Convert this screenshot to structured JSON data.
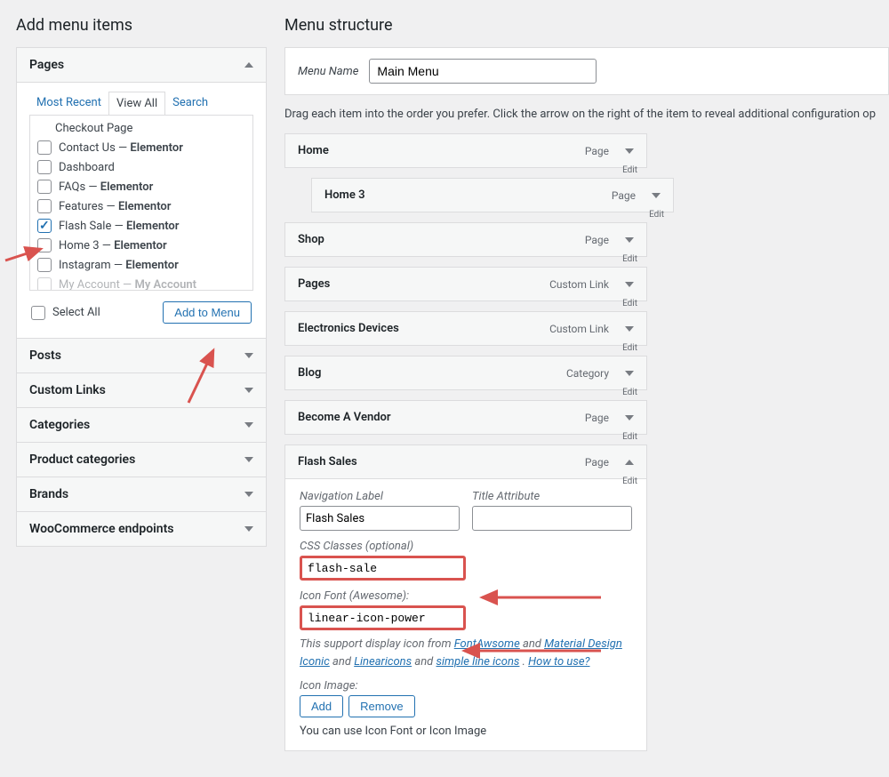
{
  "left": {
    "heading": "Add menu items",
    "pages_panel": {
      "title": "Pages",
      "tabs": {
        "recent": "Most Recent",
        "view_all": "View All",
        "search": "Search"
      },
      "items": [
        {
          "label": "Checkout Page",
          "suffix": "",
          "checked": false
        },
        {
          "label": "Contact Us",
          "suffix": " — Elementor",
          "checked": false
        },
        {
          "label": "Dashboard",
          "suffix": "",
          "checked": false
        },
        {
          "label": "FAQs",
          "suffix": " — Elementor",
          "checked": false
        },
        {
          "label": "Features",
          "suffix": " — Elementor",
          "checked": false
        },
        {
          "label": "Flash Sale",
          "suffix": " — Elementor",
          "checked": true
        },
        {
          "label": "Home 3",
          "suffix": " — Elementor",
          "checked": false
        },
        {
          "label": "Instagram",
          "suffix": " — Elementor",
          "checked": false
        },
        {
          "label": "My Account",
          "suffix": " — My Account",
          "checked": false
        }
      ],
      "select_all": "Select All",
      "add_btn": "Add to Menu"
    },
    "other_panels": [
      "Posts",
      "Custom Links",
      "Categories",
      "Product categories",
      "Brands",
      "WooCommerce endpoints"
    ]
  },
  "right": {
    "heading": "Menu structure",
    "menu_name_label": "Menu Name",
    "menu_name_value": "Main Menu",
    "help": "Drag each item into the order you prefer. Click the arrow on the right of the item to reveal additional configuration op",
    "items": [
      {
        "name": "Home",
        "type": "Page",
        "indent": 0,
        "open": false
      },
      {
        "name": "Home 3",
        "type": "Page",
        "indent": 1,
        "open": false
      },
      {
        "name": "Shop",
        "type": "Page",
        "indent": 0,
        "open": false
      },
      {
        "name": "Pages",
        "type": "Custom Link",
        "indent": 0,
        "open": false
      },
      {
        "name": "Electronics Devices",
        "type": "Custom Link",
        "indent": 0,
        "open": false
      },
      {
        "name": "Blog",
        "type": "Category",
        "indent": 0,
        "open": false
      },
      {
        "name": "Become A Vendor",
        "type": "Page",
        "indent": 0,
        "open": false
      },
      {
        "name": "Flash Sales",
        "type": "Page",
        "indent": 0,
        "open": true
      }
    ],
    "expanded": {
      "nav_label_lbl": "Navigation Label",
      "nav_label_val": "Flash Sales",
      "title_attr_lbl": "Title Attribute",
      "title_attr_val": "",
      "css_lbl": "CSS Classes (optional)",
      "css_val": "flash-sale",
      "icon_lbl": "Icon Font (Awesome):",
      "icon_val": "linear-icon-power",
      "support_pre": "This support display icon from ",
      "links": {
        "fa": "FontAwsome",
        "and1": " and ",
        "mdi": "Material Design Iconic",
        "and2": " and ",
        "li": "Linearicons",
        "and3": " and ",
        "sli": "simple line icons",
        "dot": " . ",
        "how": "How to use?"
      },
      "icon_image_lbl": "Icon Image:",
      "add_btn": "Add",
      "remove_btn": "Remove",
      "note": "You can use Icon Font or Icon Image"
    }
  }
}
